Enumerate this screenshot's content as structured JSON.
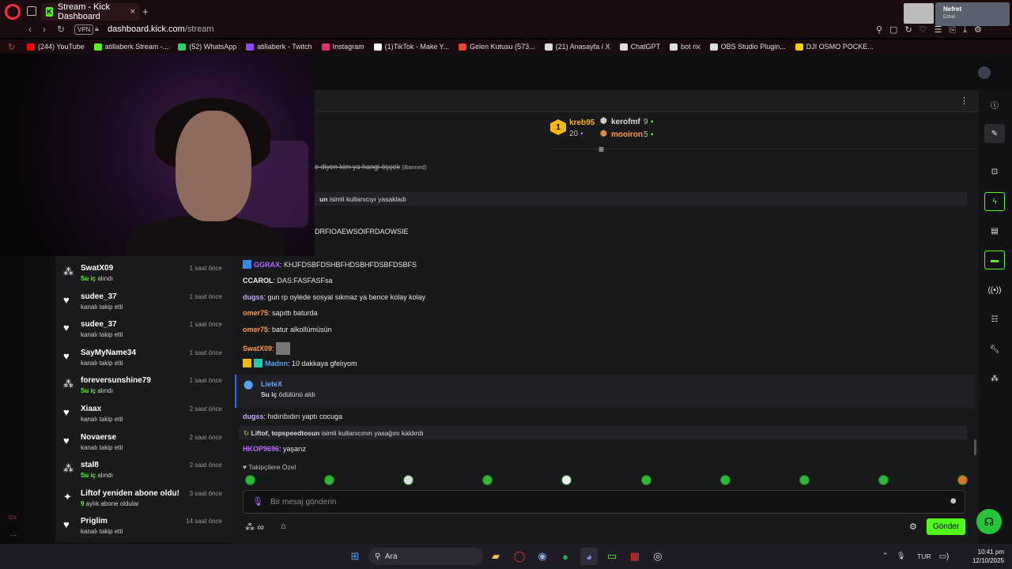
{
  "browser": {
    "tab_title": "Stream - Kick Dashboard",
    "tab_favicon": "K",
    "new_tab": "+",
    "vpn": "VPN",
    "url_host": "dashboard.kick.com",
    "url_path": "/stream",
    "bookmarks": [
      {
        "label": "(244) YouTube",
        "color": "#ff0000"
      },
      {
        "label": "atillaberk Stream -...",
        "color": "#53fc18"
      },
      {
        "label": "(52) WhatsApp",
        "color": "#25d366"
      },
      {
        "label": "atillaberk - Twitch",
        "color": "#9146ff"
      },
      {
        "label": "Instagram",
        "color": "#e1306c"
      },
      {
        "label": "(1)TikTok - Make Y...",
        "color": "#ffffff"
      },
      {
        "label": "Gelen Kutusu (573...",
        "color": "#ea4335"
      },
      {
        "label": "(21) Anasayfa / X",
        "color": "#dddddd"
      },
      {
        "label": "ChatGPT",
        "color": "#dddddd"
      },
      {
        "label": "bot rix",
        "color": "#dddddd"
      },
      {
        "label": "OBS Studio Plugin...",
        "color": "#dddddd"
      },
      {
        "label": "DJI OSMO POCKE...",
        "color": "#f5d300"
      }
    ]
  },
  "notification": {
    "title": "Nefret",
    "subtitle": "Ezhel"
  },
  "activity_feed": [
    {
      "name": "SwatX09",
      "time": "1 saat önce",
      "desc_highlight": "Su iç",
      "desc": " alındı",
      "icon": "reward-icon"
    },
    {
      "name": "sudee_37",
      "time": "1 saat önce",
      "desc_highlight": "",
      "desc": "kanalı takip etti",
      "icon": "heart-icon"
    },
    {
      "name": "sudee_37",
      "time": "1 saat önce",
      "desc_highlight": "",
      "desc": "kanalı takip etti",
      "icon": "heart-icon"
    },
    {
      "name": "SayMyName34",
      "time": "1 saat önce",
      "desc_highlight": "",
      "desc": "kanalı takip etti",
      "icon": "heart-icon"
    },
    {
      "name": "foreversunshine79",
      "time": "1 saat önce",
      "desc_highlight": "Su iç",
      "desc": " alındı",
      "icon": "reward-icon"
    },
    {
      "name": "Xiaax",
      "time": "2 saat önce",
      "desc_highlight": "",
      "desc": "kanalı takip etti",
      "icon": "heart-icon"
    },
    {
      "name": "Novaerse",
      "time": "2 saat önce",
      "desc_highlight": "",
      "desc": "kanalı takip etti",
      "icon": "heart-icon"
    },
    {
      "name": "stal8",
      "time": "2 saat önce",
      "desc_highlight": "Su iç",
      "desc": " alındı",
      "icon": "reward-icon"
    },
    {
      "name": "Liftof yeniden abone oldu!",
      "time": "3 saat önce",
      "desc_highlight": "9",
      "desc": " aylık abone oldular",
      "icon": "sparkle-icon"
    },
    {
      "name": "Priglim",
      "time": "14 saat önce",
      "desc_highlight": "",
      "desc": "kanalı takip etti",
      "icon": "heart-icon"
    }
  ],
  "leaderboard": {
    "first": {
      "rank": "1",
      "name": "kreb95",
      "count": "20"
    },
    "second": {
      "name": "kerofmf",
      "count": "9"
    },
    "third": {
      "name": "mooiron",
      "count": "5"
    }
  },
  "chat": {
    "banned_msg": "e diyen kim ya hangi öşşek",
    "banned_tag": "(Banned)",
    "ban_sys_user": "un",
    "ban_sys_text": " isimli kullanıcıyı yasakladı",
    "partial_msg": "DRFIOAEWSOIFRDAOWSIE",
    "messages": [
      {
        "user": "GGRAX",
        "color": "#b06bff",
        "text": ": KHJFDSBFDSHBFHDSBHFDSBFDSBFS"
      },
      {
        "user": "CCAROL",
        "color": "#f0f0f0",
        "text": ": DAS:FASFASFsa"
      },
      {
        "user": "dugss",
        "color": "#c9a8ff",
        "text": ": gun rp oylede sosyal sıkmaz ya bence kolay kolay"
      },
      {
        "user": "omer75",
        "color": "#ff9a3c",
        "text": ": sapıttı baturda"
      },
      {
        "user": "omer75",
        "color": "#ff9a3c",
        "text": ": batur alkollümüsün"
      },
      {
        "user": "SwatX09",
        "color": "#ff9a3c",
        "text": ":"
      },
      {
        "user": "Madnn",
        "color": "#4aa3ff",
        "text": ": 10 dakkaya gfelıyom"
      }
    ],
    "sub_card": {
      "name": "LieteX",
      "highlight": "Su iç",
      "text": " ödülünü aldı"
    },
    "after_messages": [
      {
        "user": "dugss",
        "color": "#c9a8ff",
        "text": ": hıdırıbıdırı yaptı cocuga"
      }
    ],
    "unban_users": "Liftof, topspeedtosun",
    "unban_text": " isimli kullanıcının yasağını kaldırdı",
    "last_message": {
      "user": "HKOP9696",
      "color": "#c06bff",
      "text": ": yaşarız"
    },
    "followers_only": "Takipçilere Özel",
    "placeholder": "Bir mesaj gönderin",
    "send_label": "Gönder"
  },
  "taskbar": {
    "search": "Ara",
    "lang": "TUR",
    "time": "10:41 pm",
    "date": "12/10/2025"
  },
  "colors": {
    "accent": "#53fc18",
    "panel": "#18191b"
  }
}
